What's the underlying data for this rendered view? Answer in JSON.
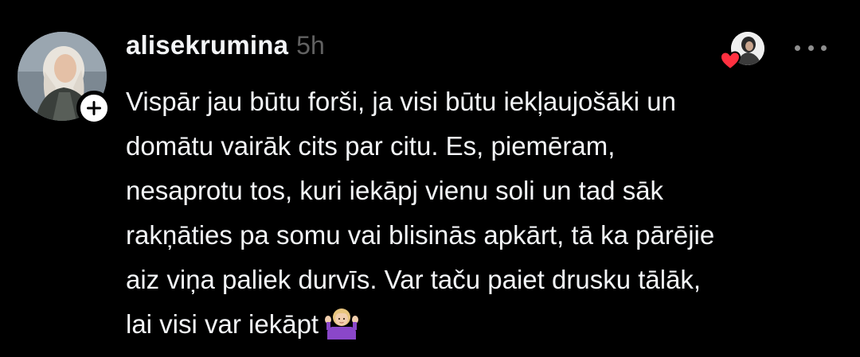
{
  "post": {
    "username": "alisekrumina",
    "timestamp": "5h",
    "body_lines": [
      "Vispār jau būtu forši, ja visi būtu iekļaujošāki un",
      "domātu vairāk cits par citu. Es, piemēram,",
      "nesaprotu tos, kuri iekāpj vienu soli un tad sāk",
      "rakņāties pa somu vai blisinās apkārt, tā ka pārējie",
      "aiz viņa paliek durvīs. Var taču paiet drusku tālāk,",
      "lai visi var iekāpt"
    ],
    "trailing_emoji": "person-shrugging-emoji"
  },
  "icons": {
    "follow": "plus-icon",
    "like": "heart-icon",
    "more": "more-options-icon"
  },
  "colors": {
    "background": "#000000",
    "text": "#f3f5f7",
    "muted": "#616161",
    "heart": "#ff3040",
    "more_dots": "#8e8e8e"
  }
}
